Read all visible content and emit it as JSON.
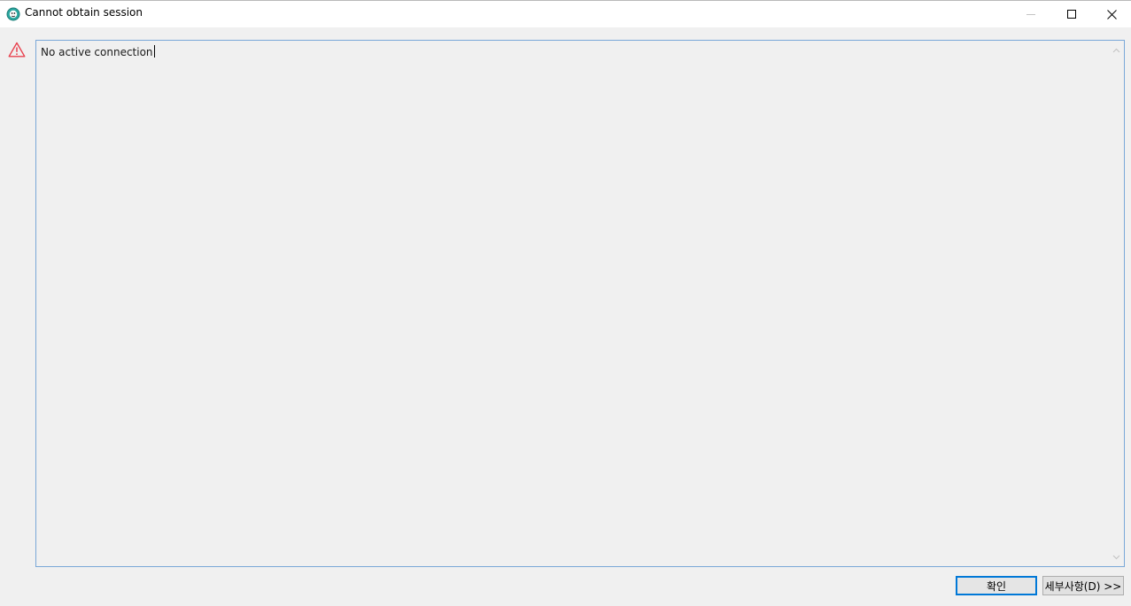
{
  "window": {
    "title": "Cannot obtain session"
  },
  "message": {
    "text": "No active connection"
  },
  "buttons": {
    "ok_label": "확인",
    "details_label": "세부사항(D) >>"
  },
  "icons": {
    "app": "app-icon",
    "warning": "warning-icon",
    "minimize": "minimize-icon",
    "maximize": "maximize-icon",
    "close": "close-icon",
    "scroll_up": "chevron-up-icon",
    "scroll_down": "chevron-down-icon"
  },
  "colors": {
    "warning": "#e8404d",
    "focus_border": "#7aa8d8",
    "button_focus": "#0078d7",
    "app_icon": "#2aa7a0"
  }
}
